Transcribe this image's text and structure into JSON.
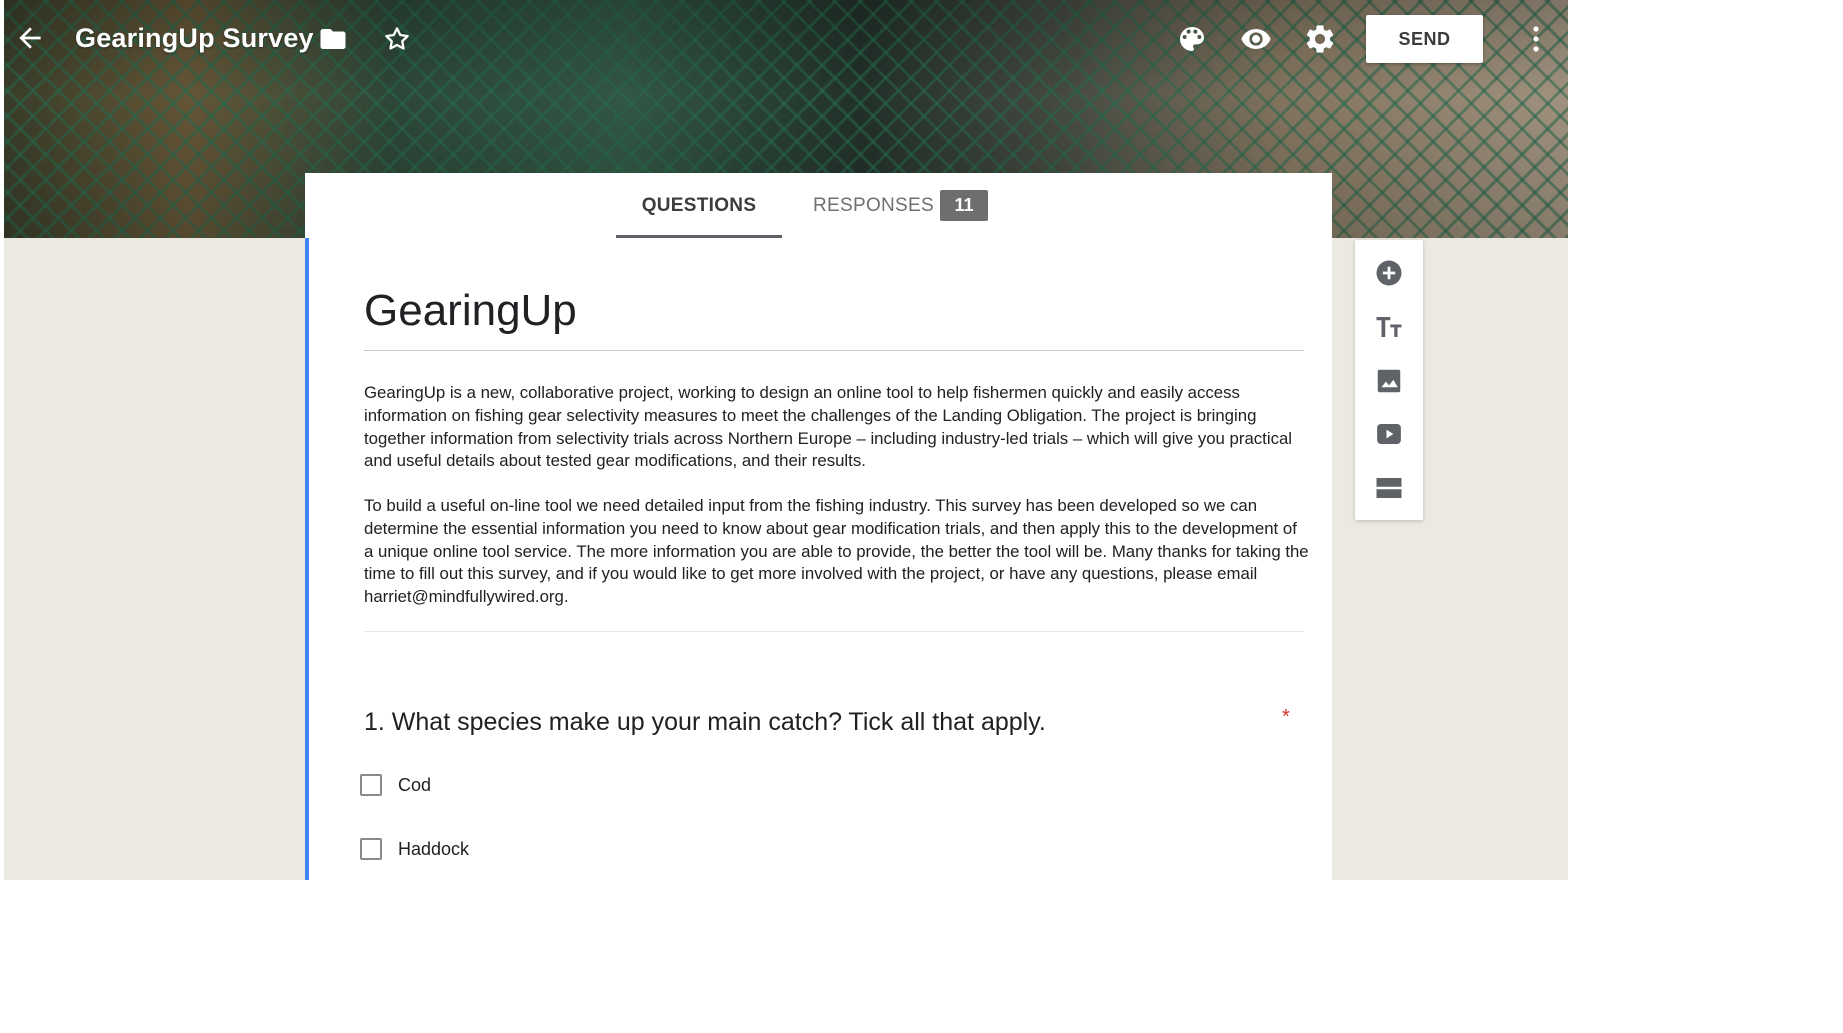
{
  "header": {
    "title": "GearingUp Survey",
    "send_label": "SEND",
    "icons": [
      "back-arrow-icon",
      "folder-icon",
      "star-icon",
      "palette-icon",
      "eye-icon",
      "gear-icon",
      "more-vert-icon"
    ]
  },
  "tabs": {
    "questions": "QUESTIONS",
    "responses": "RESPONSES",
    "responses_count": "11"
  },
  "form": {
    "title": "GearingUp",
    "description_1": "GearingUp is a new, collaborative project, working to design an online tool to help fishermen quickly and easily access information on fishing gear selectivity measures to meet the challenges of the Landing Obligation. The project is bringing together information from selectivity trials across Northern Europe – including industry-led trials – which will give you practical and useful details about tested gear modifications, and their results.",
    "description_2": "To build a useful on-line tool we need detailed input from the fishing industry. This survey has been developed so we can determine the essential information you need to know about gear modification trials, and then apply this to the development of a unique online tool service. The more information you are able to provide, the better the tool will be. Many thanks for taking the time to fill out this survey, and if you would like to get more involved with the project, or have any questions, please email harriet@mindfullywired.org."
  },
  "question_1": {
    "title": "1. What species make up your main catch? Tick all that apply.",
    "required_mark": "*",
    "options": [
      "Cod",
      "Haddock"
    ]
  },
  "side_toolbar": {
    "icons": [
      "add-question-icon",
      "add-title-icon",
      "add-image-icon",
      "add-video-icon",
      "add-section-icon"
    ]
  },
  "colors": {
    "accent": "#4285f4",
    "required": "#d93025",
    "badge": "#6e6e6e"
  }
}
